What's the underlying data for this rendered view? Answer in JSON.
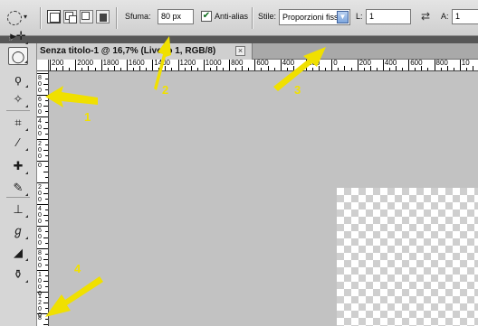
{
  "options_bar": {
    "feather_label": "Sfuma:",
    "feather_value": "80 px",
    "antialias_label": "Anti-alias",
    "antialias_checked": true,
    "style_label": "Stile:",
    "style_value": "Proporzioni fisse",
    "width_label": "L:",
    "width_value": "1",
    "height_label": "A:",
    "height_value": "1"
  },
  "document": {
    "tab_title": "Senza titolo-1 @ 16,7% (Livello 1, RGB/8)"
  },
  "rulers": {
    "horizontal": [
      "200",
      "2000",
      "1800",
      "1600",
      "1400",
      "1200",
      "1000",
      "800",
      "600",
      "400",
      "200",
      "0",
      "200",
      "400",
      "600",
      "800",
      "10"
    ],
    "vertical": [
      "8\n0\n0",
      "6\n0\n0",
      "4\n0\n0",
      "2\n0\n0",
      "0",
      "2\n0\n0",
      "4\n0\n0",
      "6\n0\n0",
      "8\n0\n0",
      "1\n0\n0\n0",
      "1\n2\n0\n0",
      "8"
    ]
  },
  "toolbar": {
    "tools": [
      {
        "name": "move-tool",
        "icon": "move-icon",
        "glyph": "▸✛"
      },
      {
        "name": "elliptical-marquee-tool",
        "icon": "elliptical-marquee-icon",
        "glyph": "◯",
        "active": true
      },
      {
        "name": "lasso-tool",
        "icon": "lasso-icon",
        "glyph": "ϙ"
      },
      {
        "name": "quick-selection-tool",
        "icon": "magic-wand-icon",
        "glyph": "✧"
      },
      {
        "name": "crop-tool",
        "icon": "crop-icon",
        "glyph": "⌗"
      },
      {
        "name": "eyedropper-tool",
        "icon": "eyedropper-icon",
        "glyph": "⁄"
      },
      {
        "name": "healing-brush-tool",
        "icon": "bandage-icon",
        "glyph": "✚"
      },
      {
        "name": "brush-tool",
        "icon": "brush-icon",
        "glyph": "✎"
      },
      {
        "name": "clone-stamp-tool",
        "icon": "stamp-icon",
        "glyph": "⊥"
      },
      {
        "name": "history-brush-tool",
        "icon": "history-brush-icon",
        "glyph": "ℊ"
      },
      {
        "name": "eraser-tool",
        "icon": "eraser-icon",
        "glyph": "◢"
      },
      {
        "name": "paint-bucket-tool",
        "icon": "bucket-icon",
        "glyph": "⚱"
      }
    ]
  },
  "annotations": [
    {
      "number": "1",
      "points_to": "elliptical-marquee-tool"
    },
    {
      "number": "2",
      "points_to": "feather-field"
    },
    {
      "number": "3",
      "points_to": "style-select"
    },
    {
      "number": "4",
      "points_to": "vertical-ruler"
    }
  ],
  "colors": {
    "annotation_yellow": "#f0e000",
    "canvas_gray": "#c2c2c2",
    "select_arrow_blue": "#7ea6dd"
  }
}
